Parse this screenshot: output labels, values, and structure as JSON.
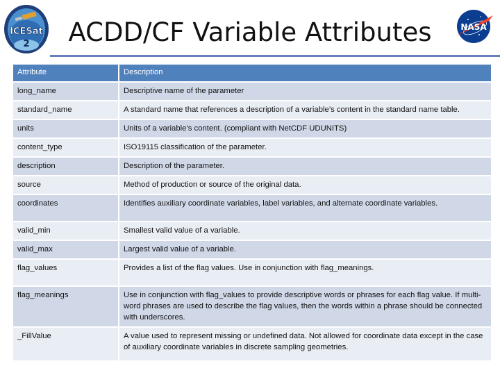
{
  "slide": {
    "title": "ACDD/CF Variable Attributes",
    "logos": {
      "left": {
        "name": "ICESat-2",
        "text": "ICESat",
        "number": "2"
      },
      "right": {
        "name": "NASA",
        "text": "NASA"
      }
    },
    "colors": {
      "header_bg": "#4f81bd",
      "row_odd": "#d0d8e8",
      "row_even": "#e9edf4",
      "divider": "#6a7fbd"
    }
  },
  "table": {
    "headers": [
      "Attribute",
      "Description"
    ],
    "rows": [
      {
        "attribute": "long_name",
        "description": "Descriptive name of the parameter"
      },
      {
        "attribute": "standard_name",
        "description": "A standard name that references a description of a variable’s content in the standard name table."
      },
      {
        "attribute": "units",
        "description": "Units of a variable’s content. (compliant with NetCDF UDUNITS)"
      },
      {
        "attribute": "content_type",
        "description": "ISO19115 classification of the parameter."
      },
      {
        "attribute": "description",
        "description": "Description of the parameter."
      },
      {
        "attribute": "source",
        "description": "Method of production or source of the original data."
      },
      {
        "attribute": "coordinates",
        "description": "Identifies auxiliary coordinate variables, label variables, and alternate coordinate variables."
      },
      {
        "attribute": "valid_min",
        "description": "Smallest valid value of a variable."
      },
      {
        "attribute": "valid_max",
        "description": "Largest valid value of a variable."
      },
      {
        "attribute": "flag_values",
        "description": "Provides a list of the flag values. Use in conjunction with flag_meanings."
      },
      {
        "attribute": "flag_meanings",
        "description": "Use in conjunction with flag_values to provide descriptive words or phrases for each flag value. If multi-word phrases are used to describe the flag values, then the words within a phrase should be connected with underscores."
      },
      {
        "attribute": "_FillValue",
        "description": "A value used to represent missing or undefined data. Not allowed for coordinate data except in the case of auxiliary coordinate variables in discrete sampling geometries."
      }
    ]
  }
}
